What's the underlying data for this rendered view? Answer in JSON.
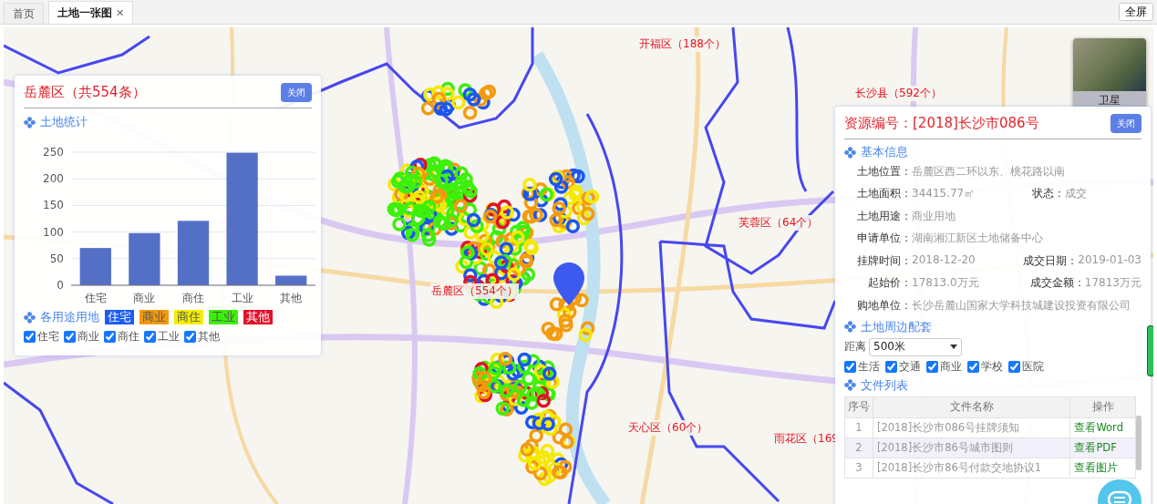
{
  "tabs": [
    {
      "label": "首页",
      "selected": false,
      "closable": false
    },
    {
      "label": "土地一张图",
      "selected": true,
      "closable": true,
      "close_icon": "✕"
    }
  ],
  "fullscreen_button": "全屏",
  "map": {
    "district_labels": [
      {
        "text": "开福区（188个）"
      },
      {
        "text": "长沙县（592个）"
      },
      {
        "text": "芙蓉区（64个）"
      },
      {
        "text": "岳麓区（554个）"
      },
      {
        "text": "天心区（60个）"
      },
      {
        "text": "雨花区（169"
      }
    ],
    "basemap_switch": {
      "label": "卫星",
      "selected": false
    }
  },
  "stats_panel": {
    "title": "岳麓区（共554条）",
    "close_button": "关闭",
    "chart_heading": "土地统计",
    "chart_data": {
      "type": "bar",
      "categories": [
        "住宅",
        "商业",
        "商住",
        "工业",
        "其他"
      ],
      "values": [
        70,
        98,
        121,
        249,
        18
      ],
      "ylim": [
        0,
        250
      ],
      "grid": true,
      "yticks": [
        0,
        50,
        100,
        150,
        200,
        250
      ]
    },
    "legend_heading": "各用途用地",
    "legend": [
      {
        "label": "住宅",
        "color": "#1a5cf5"
      },
      {
        "label": "商业",
        "color": "#f59a0c"
      },
      {
        "label": "商住",
        "color": "#f5ee00"
      },
      {
        "label": "工业",
        "color": "#3cf00a"
      },
      {
        "label": "其他",
        "color": "#e3112a"
      }
    ],
    "filters": [
      {
        "label": "住宅",
        "checked": true
      },
      {
        "label": "商业",
        "checked": true
      },
      {
        "label": "商住",
        "checked": true
      },
      {
        "label": "工业",
        "checked": true
      },
      {
        "label": "其他",
        "checked": true
      }
    ]
  },
  "detail_panel": {
    "title": "资源编号：[2018]长沙市086号",
    "close_button": "关闭",
    "basic_heading": "基本信息",
    "basic_rows": [
      [
        {
          "label": "土地位置：",
          "value": "岳麓区西二环以东、桃花路以南"
        }
      ],
      [
        {
          "label": "土地面积：",
          "value": "34415.77㎡"
        },
        {
          "label": "状态：",
          "value": "成交"
        }
      ],
      [
        {
          "label": "土地用途：",
          "value": "商业用地"
        }
      ],
      [
        {
          "label": "申请单位：",
          "value": "湖南湘江新区土地储备中心"
        }
      ],
      [
        {
          "label": "挂牌时间：",
          "value": "2018-12-20"
        },
        {
          "label": "成交日期：",
          "value": "2019-01-03"
        }
      ],
      [
        {
          "label": "起始价：",
          "value": "17813.0万元"
        },
        {
          "label": "成交金额：",
          "value": "17813万元"
        }
      ],
      [
        {
          "label": "购地单位：",
          "value": "长沙岳麓山国家大学科技城建设投资有限公司"
        }
      ]
    ],
    "surroundings_heading": "土地周边配套",
    "distance_label": "距离",
    "distance_value": "500米",
    "surroundings": [
      {
        "label": "生活",
        "checked": true
      },
      {
        "label": "交通",
        "checked": true
      },
      {
        "label": "商业",
        "checked": true
      },
      {
        "label": "学校",
        "checked": true
      },
      {
        "label": "医院",
        "checked": true
      }
    ],
    "files_heading": "文件列表",
    "file_columns": [
      "序号",
      "文件名称",
      "操作"
    ],
    "files": [
      {
        "index": "1",
        "name": "[2018]长沙市086号挂牌须知",
        "action": "查看Word"
      },
      {
        "index": "2",
        "name": "[2018]长沙市86号城市图则",
        "action": "查看PDF"
      },
      {
        "index": "3",
        "name": "[2018]长沙市86号付款交地协议1",
        "action": "查看图片"
      }
    ]
  }
}
